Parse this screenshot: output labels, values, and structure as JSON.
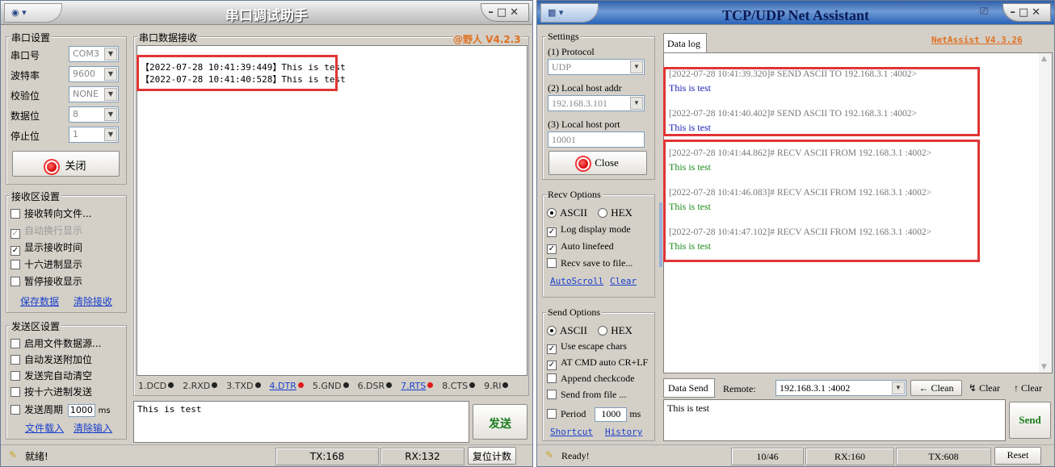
{
  "left": {
    "title": "串口调试助手",
    "serial_group": "串口设置",
    "fields": [
      {
        "label": "串口号",
        "value": "COM3"
      },
      {
        "label": "波特率",
        "value": "9600"
      },
      {
        "label": "校验位",
        "value": "NONE"
      },
      {
        "label": "数据位",
        "value": "8"
      },
      {
        "label": "停止位",
        "value": "1"
      }
    ],
    "close_button": "关闭",
    "recv_group": "接收区设置",
    "recv_options": [
      {
        "label": "接收转向文件...",
        "checked": false,
        "disabled": false
      },
      {
        "label": "自动换行显示",
        "checked": true,
        "disabled": true
      },
      {
        "label": "显示接收时间",
        "checked": true,
        "disabled": false
      },
      {
        "label": "十六进制显示",
        "checked": false,
        "disabled": false
      },
      {
        "label": "暂停接收显示",
        "checked": false,
        "disabled": false
      }
    ],
    "save_data": "保存数据",
    "clear_recv": "清除接收",
    "send_group": "发送区设置",
    "send_options": [
      {
        "label": "启用文件数据源...",
        "checked": false
      },
      {
        "label": "自动发送附加位",
        "checked": false
      },
      {
        "label": "发送完自动清空",
        "checked": false
      },
      {
        "label": "按十六进制发送",
        "checked": false
      }
    ],
    "send_period_label": "发送周期",
    "send_period_value": "1000",
    "send_period_unit": "ms",
    "load_file": "文件载入",
    "clear_input": "清除输入",
    "recv_area_label": "串口数据接收",
    "brand": "@野人 V4.2.3",
    "recv_lines": [
      "【2022-07-28 10:41:39:449】This is test",
      "【2022-07-28 10:41:40:528】This is test"
    ],
    "signals": [
      {
        "label": "1.DCD",
        "led": "black",
        "link": false
      },
      {
        "label": "2.RXD",
        "led": "black",
        "link": false
      },
      {
        "label": "3.TXD",
        "led": "black",
        "link": false
      },
      {
        "label": "4.DTR",
        "led": "red",
        "link": true
      },
      {
        "label": "5.GND",
        "led": "black",
        "link": false
      },
      {
        "label": "6.DSR",
        "led": "black",
        "link": false
      },
      {
        "label": "7.RTS",
        "led": "red",
        "link": true
      },
      {
        "label": "8.CTS",
        "led": "black",
        "link": false
      },
      {
        "label": "9.RI",
        "led": "black",
        "link": false
      }
    ],
    "send_text": "This is test",
    "send_button": "发送",
    "status_ready": "就绪!",
    "tx": "TX:168",
    "rx": "RX:132",
    "reset_count": "复位计数"
  },
  "right": {
    "title": "TCP/UDP Net Assistant",
    "settings_group": "Settings",
    "protocol_label": "(1) Protocol",
    "protocol_value": "UDP",
    "local_addr_label": "(2) Local host addr",
    "local_addr_value": "192.168.3.101",
    "local_port_label": "(3) Local host port",
    "local_port_value": "10001",
    "close_button": "Close",
    "recv_group": "Recv Options",
    "recv_ascii": "ASCII",
    "recv_hex": "HEX",
    "recv_checks": [
      {
        "label": "Log display mode",
        "checked": true
      },
      {
        "label": "Auto linefeed",
        "checked": true
      },
      {
        "label": "Recv save to file...",
        "checked": false
      }
    ],
    "autoscroll": "AutoScroll",
    "clear": "Clear",
    "send_group": "Send Options",
    "send_ascii": "ASCII",
    "send_hex": "HEX",
    "send_checks": [
      {
        "label": "Use escape chars",
        "checked": true
      },
      {
        "label": "AT CMD auto CR+LF",
        "checked": true
      },
      {
        "label": "Append checkcode",
        "checked": false
      },
      {
        "label": "Send from file ...",
        "checked": false
      }
    ],
    "period_label": "Period",
    "period_value": "1000",
    "period_unit": "ms",
    "shortcut": "Shortcut",
    "history": "History",
    "data_log_tab": "Data log",
    "brand": "NetAssist V4.3.26",
    "log": [
      {
        "head": "[2022-07-28 10:41:39.320]# SEND ASCII TO 192.168.3.1 :4002>",
        "text": "This is test",
        "color": "#1a1ab8"
      },
      {
        "head": "[2022-07-28 10:41:40.402]# SEND ASCII TO 192.168.3.1 :4002>",
        "text": "This is test",
        "color": "#1a1ab8"
      },
      {
        "head": "[2022-07-28 10:41:44.862]# RECV ASCII FROM 192.168.3.1 :4002>",
        "text": "This is test",
        "color": "#1a8a1a"
      },
      {
        "head": "[2022-07-28 10:41:46.083]# RECV ASCII FROM 192.168.3.1 :4002>",
        "text": "This is test",
        "color": "#1a8a1a"
      },
      {
        "head": "[2022-07-28 10:41:47.102]# RECV ASCII FROM 192.168.3.1 :4002>",
        "text": "This is test",
        "color": "#1a8a1a"
      }
    ],
    "data_send_tab": "Data Send",
    "remote_label": "Remote:",
    "remote_value": "192.168.3.1 :4002",
    "clean_button": "Clean",
    "clear_button_a": "Clear",
    "clear_button_b": "Clear",
    "send_text": "This is test",
    "send_button": "Send",
    "status_ready": "Ready!",
    "count": "10/46",
    "rx": "RX:160",
    "tx": "TX:608",
    "reset_button": "Reset"
  }
}
